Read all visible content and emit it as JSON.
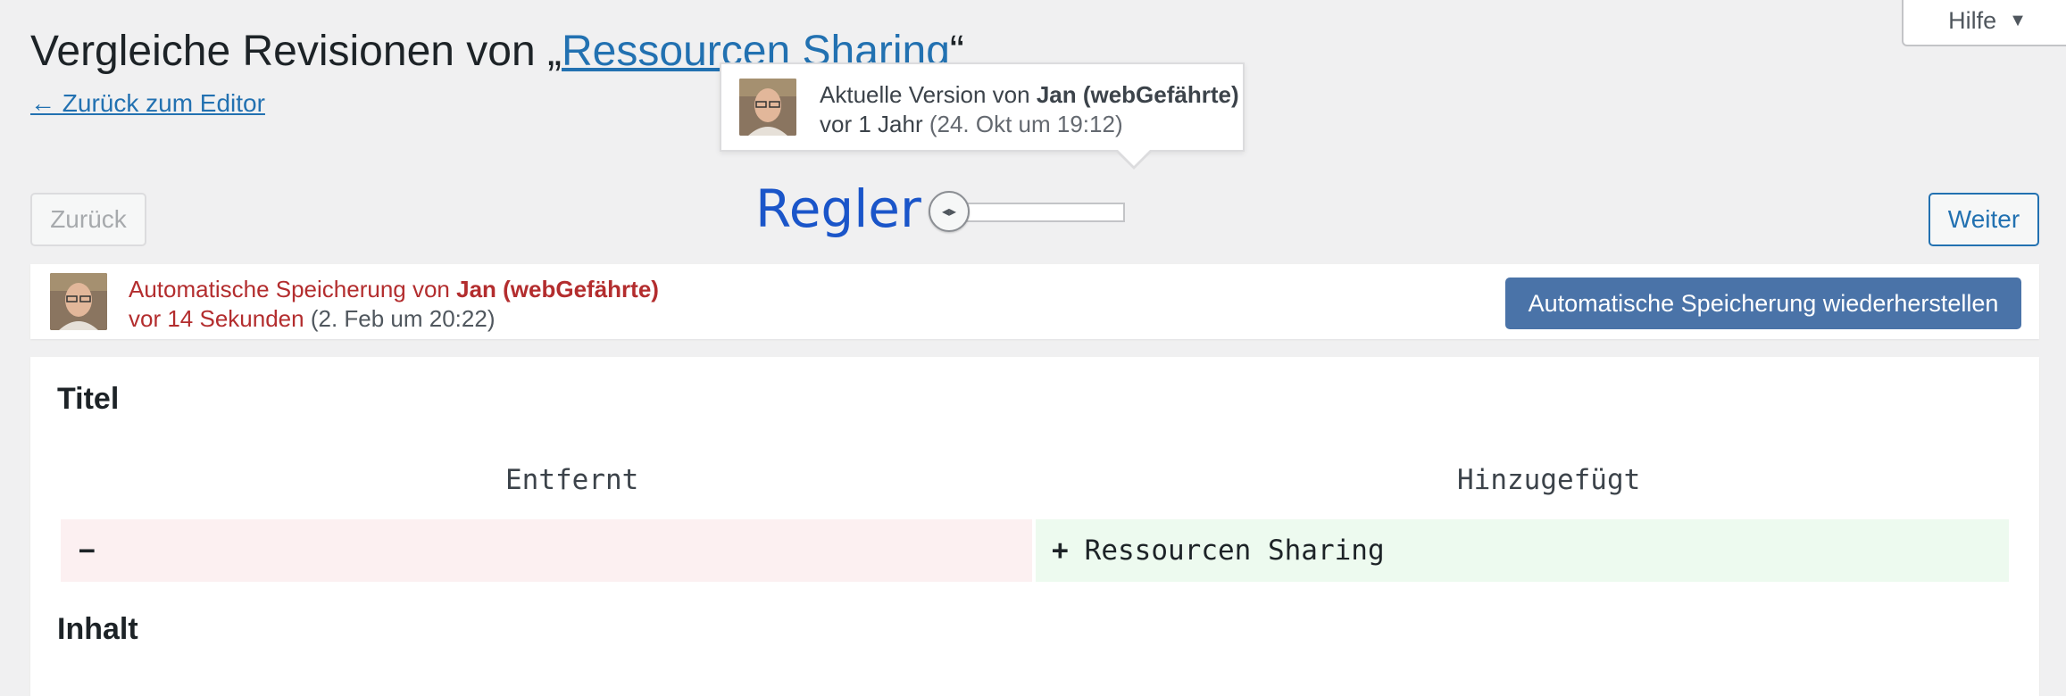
{
  "help": {
    "label": "Hilfe",
    "icon": "caret-down-icon"
  },
  "title": {
    "prefix": "Vergleiche Revisionen von „",
    "post_title": "Ressourcen Sharing",
    "suffix": "“"
  },
  "back_to_editor": "← Zurück zum Editor",
  "tooltip": {
    "line1_prefix": "Aktuelle Version von ",
    "author": "Jan (webGefährte)",
    "line2_relative": "vor 1 Jahr",
    "line2_date": "(24. Okt um 19:12)"
  },
  "nav": {
    "prev_label": "Zurück",
    "next_label": "Weiter"
  },
  "slider": {
    "annotation": "Regler",
    "handle_icon": "arrows-left-right-icon",
    "position": 0
  },
  "autosave": {
    "line1_prefix": "Automatische Speicherung von ",
    "author": "Jan (webGefährte)",
    "line2_relative": "vor 14 Sekunden",
    "line2_date": "(2. Feb um 20:22)",
    "restore_label": "Automatische Speicherung wiederherstellen"
  },
  "diff": {
    "section_title": "Titel",
    "removed_header": "Entfernt",
    "added_header": "Hinzugefügt",
    "removed_sign": "−",
    "removed_text": "",
    "added_sign": "+",
    "added_text": "Ressourcen Sharing",
    "next_section": "Inhalt"
  },
  "colors": {
    "link": "#2271b1",
    "autosave_text": "#b32d2e",
    "restore_button": "#4a73a8",
    "removed_bg": "#fcf0f1",
    "added_bg": "#edfaef",
    "annotation": "#1a55c9"
  }
}
